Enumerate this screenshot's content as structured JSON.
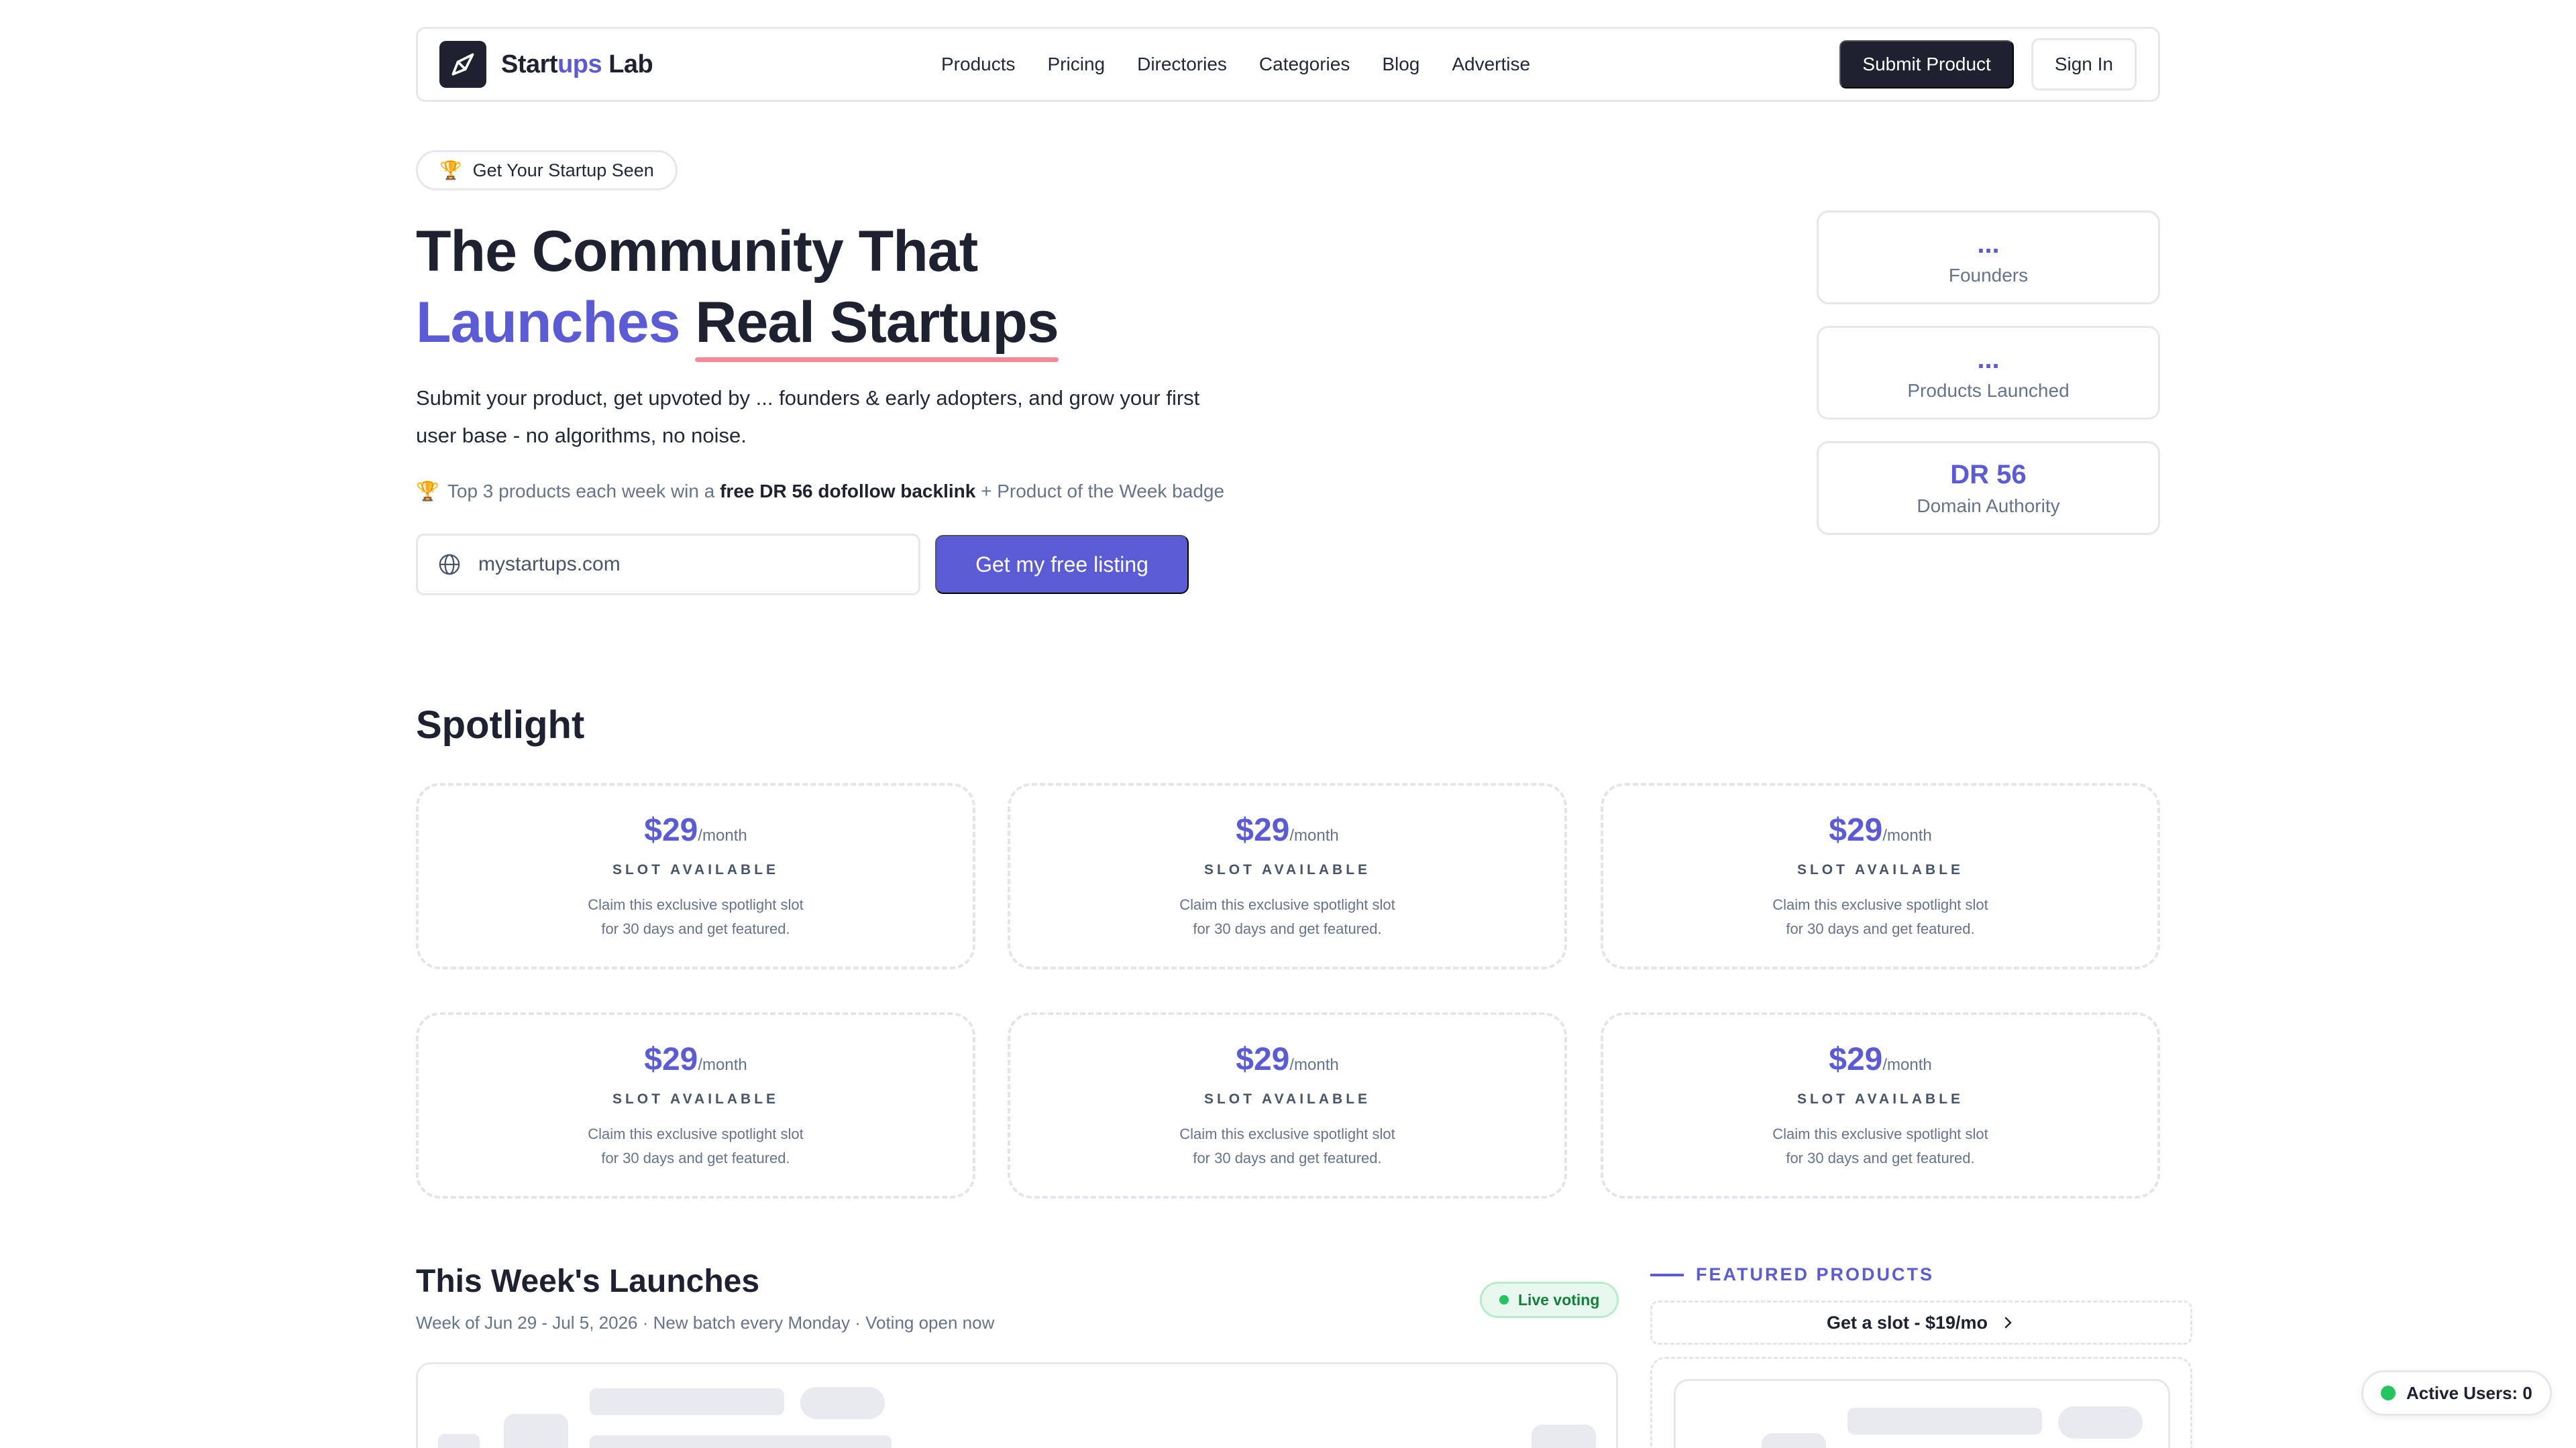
{
  "brand": {
    "name_a": "Start",
    "name_b": "ups",
    "name_c": " Lab"
  },
  "nav": {
    "links": [
      "Products",
      "Pricing",
      "Directories",
      "Categories",
      "Blog",
      "Advertise"
    ],
    "submit_label": "Submit Product",
    "signin_label": "Sign In"
  },
  "hero": {
    "pill_icon": "🏆",
    "pill_label": "Get Your Startup Seen",
    "title_line1": "The Community That",
    "title_violet": "Launches",
    "title_underlined": "Real Startups",
    "subtitle": "Submit your product, get upvoted by ... founders & early adopters, and grow your first user base - no algorithms, no noise.",
    "note_icon": "🏆",
    "note_pre": "Top 3 products each week win a",
    "note_bold": "free DR 56 dofollow backlink",
    "note_post": "+ Product of the Week badge",
    "input_value": "mystartups.com",
    "cta_label": "Get my free listing"
  },
  "stats": [
    {
      "value": "...",
      "label": "Founders"
    },
    {
      "value": "...",
      "label": "Products Launched"
    },
    {
      "value": "DR 56",
      "label": "Domain Authority"
    }
  ],
  "spotlight": {
    "heading": "Spotlight",
    "slots": [
      {
        "price": "$29",
        "period": "/month",
        "tag": "SLOT AVAILABLE",
        "desc1": "Claim this exclusive spotlight slot",
        "desc2": "for 30 days and get featured."
      },
      {
        "price": "$29",
        "period": "/month",
        "tag": "SLOT AVAILABLE",
        "desc1": "Claim this exclusive spotlight slot",
        "desc2": "for 30 days and get featured."
      },
      {
        "price": "$29",
        "period": "/month",
        "tag": "SLOT AVAILABLE",
        "desc1": "Claim this exclusive spotlight slot",
        "desc2": "for 30 days and get featured."
      },
      {
        "price": "$29",
        "period": "/month",
        "tag": "SLOT AVAILABLE",
        "desc1": "Claim this exclusive spotlight slot",
        "desc2": "for 30 days and get featured."
      },
      {
        "price": "$29",
        "period": "/month",
        "tag": "SLOT AVAILABLE",
        "desc1": "Claim this exclusive spotlight slot",
        "desc2": "for 30 days and get featured."
      },
      {
        "price": "$29",
        "period": "/month",
        "tag": "SLOT AVAILABLE",
        "desc1": "Claim this exclusive spotlight slot",
        "desc2": "for 30 days and get featured."
      }
    ]
  },
  "launches": {
    "title": "This Week's Launches",
    "subtitle": "Week of Jun 29 - Jul 5, 2026 · New batch every Monday · Voting open now",
    "live_label": "Live voting"
  },
  "featured": {
    "label": "FEATURED PRODUCTS",
    "slot_label": "Get a slot - $19/mo"
  },
  "active_users": {
    "label": "Active Users: 0"
  },
  "colors": {
    "accent": "#5b5bd6",
    "dark": "#1e2230",
    "underline": "#f28b96",
    "live": "#22c55e"
  }
}
